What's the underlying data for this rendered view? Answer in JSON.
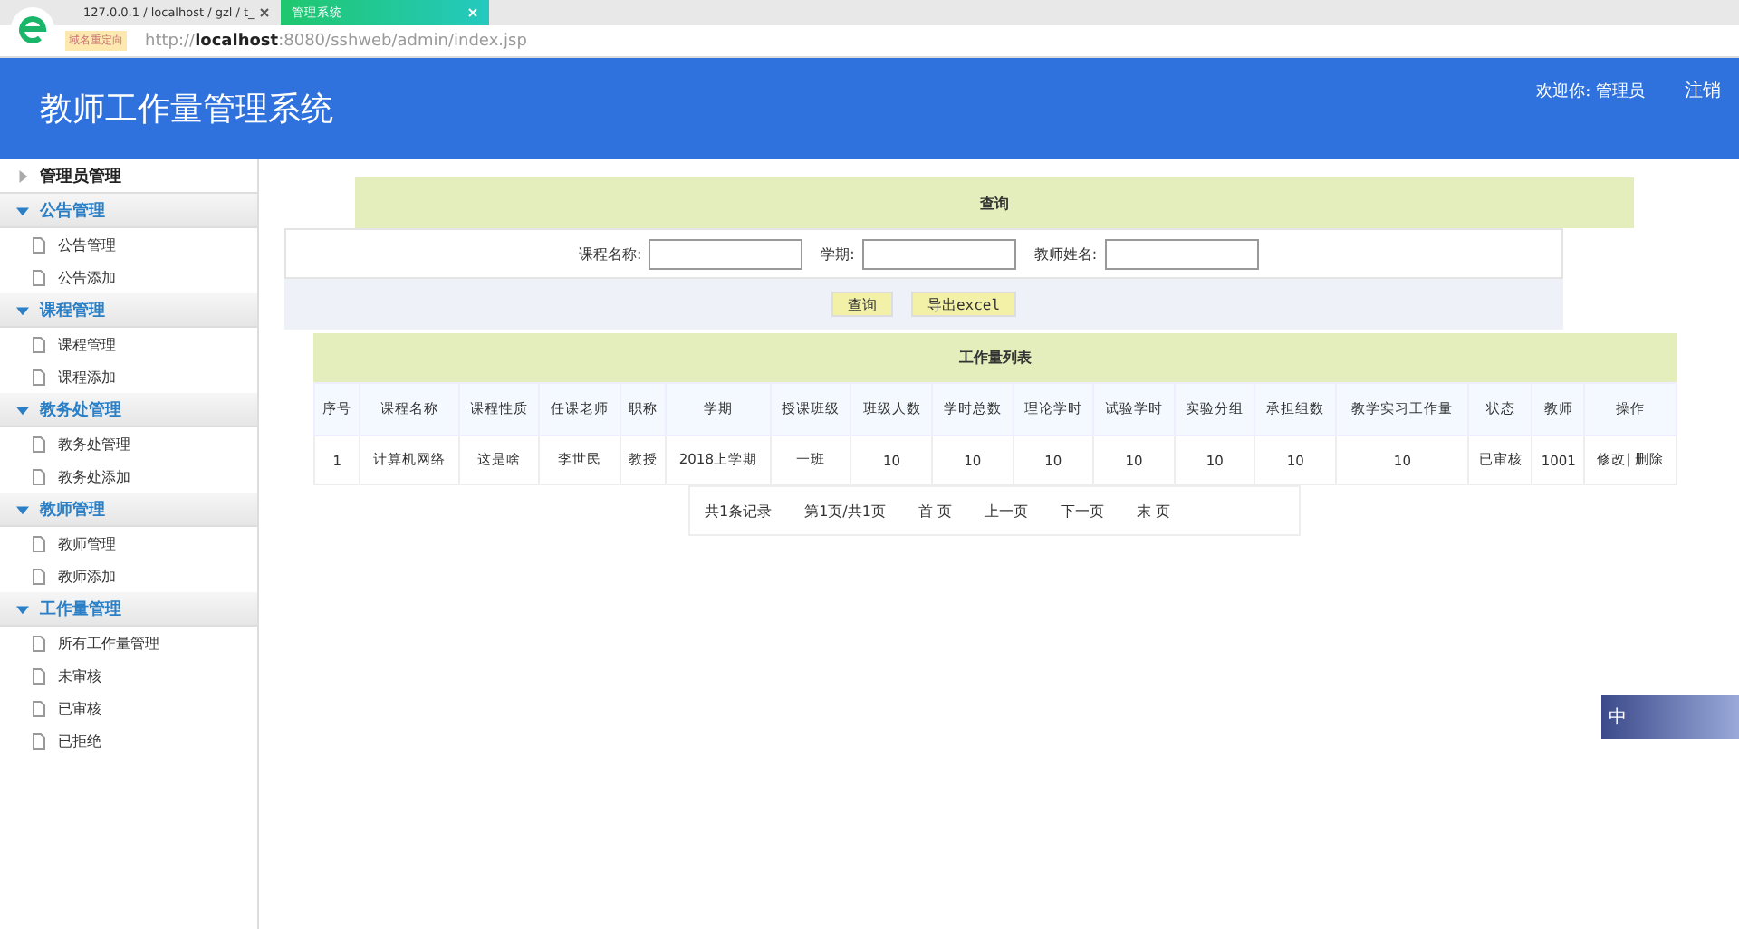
{
  "browser": {
    "tabs": [
      {
        "label": "127.0.0.1 / localhost / gzl / t_",
        "selected": false
      },
      {
        "label": "管理系统",
        "selected": true
      }
    ],
    "badge": "域名重定向",
    "url_prefix": "http://",
    "url_host": "localhost",
    "url_rest": ":8080/sshweb/admin/index.jsp"
  },
  "header": {
    "title": "教师工作量管理系统",
    "welcome": "欢迎你: 管理员",
    "logout": "注销"
  },
  "sidebar": {
    "groups": [
      {
        "label": "管理员管理",
        "expanded": false
      },
      {
        "label": "公告管理",
        "expanded": true,
        "items": [
          "公告管理",
          "公告添加"
        ]
      },
      {
        "label": "课程管理",
        "expanded": true,
        "items": [
          "课程管理",
          "课程添加"
        ]
      },
      {
        "label": "教务处管理",
        "expanded": true,
        "items": [
          "教务处管理",
          "教务处添加"
        ]
      },
      {
        "label": "教师管理",
        "expanded": true,
        "items": [
          "教师管理",
          "教师添加"
        ]
      },
      {
        "label": "工作量管理",
        "expanded": true,
        "items": [
          "所有工作量管理",
          "未审核",
          "已审核",
          "已拒绝"
        ]
      }
    ]
  },
  "query": {
    "title": "查询",
    "fields": [
      {
        "label": "课程名称:"
      },
      {
        "label": "学期:"
      },
      {
        "label": "教师姓名:"
      }
    ],
    "buttons": [
      "查询",
      "导出excel"
    ]
  },
  "table": {
    "title": "工作量列表",
    "columns": [
      "序号",
      "课程名称",
      "课程性质",
      "任课老师",
      "职称",
      "学期",
      "授课班级",
      "班级人数",
      "学时总数",
      "理论学时",
      "试验学时",
      "实验分组",
      "承担组数",
      "教学实习工作量",
      "状态",
      "教师",
      "操作"
    ],
    "rows": [
      {
        "cells": [
          "1",
          "计算机网络",
          "这是啥",
          "李世民",
          "教授",
          "2018上学期",
          "一班",
          "10",
          "10",
          "10",
          "10",
          "10",
          "10",
          "10",
          "已审核",
          "1001"
        ],
        "actions": [
          "修改",
          "删除"
        ],
        "separator": "|"
      }
    ]
  },
  "pagination": {
    "summary": "共1条记录",
    "page": "第1页/共1页",
    "links": [
      "首 页",
      "上一页",
      "下一页",
      "末 页"
    ]
  },
  "ime": {
    "label": "中"
  }
}
